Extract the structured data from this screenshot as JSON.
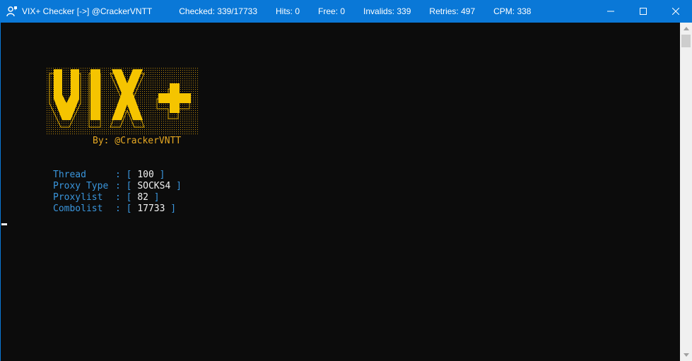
{
  "window": {
    "title": "VIX+ Checker [->] @CrackerVNTT",
    "app_icon": "person-speech-icon"
  },
  "stats": [
    {
      "label": "Checked: 339/17733"
    },
    {
      "label": "Hits: 0"
    },
    {
      "label": "Free: 0"
    },
    {
      "label": "Invalids: 339"
    },
    {
      "label": "Retries: 497"
    },
    {
      "label": "CPM: 338"
    }
  ],
  "banner": {
    "logo_text": "VIX+",
    "byline": "By: @CrackerVNTT",
    "logo_color": "#f5c400",
    "byline_color": "#e6a822"
  },
  "config": [
    {
      "label": "Thread",
      "value": "100"
    },
    {
      "label": "Proxy Type",
      "value": "SOCKS4"
    },
    {
      "label": "Proxylist",
      "value": "82"
    },
    {
      "label": "Combolist",
      "value": "17733"
    }
  ],
  "colors": {
    "titlebar": "#0a78d7",
    "terminal_bg": "#0c0c0c",
    "label": "#3a96dd",
    "value": "#f2f2f2"
  }
}
